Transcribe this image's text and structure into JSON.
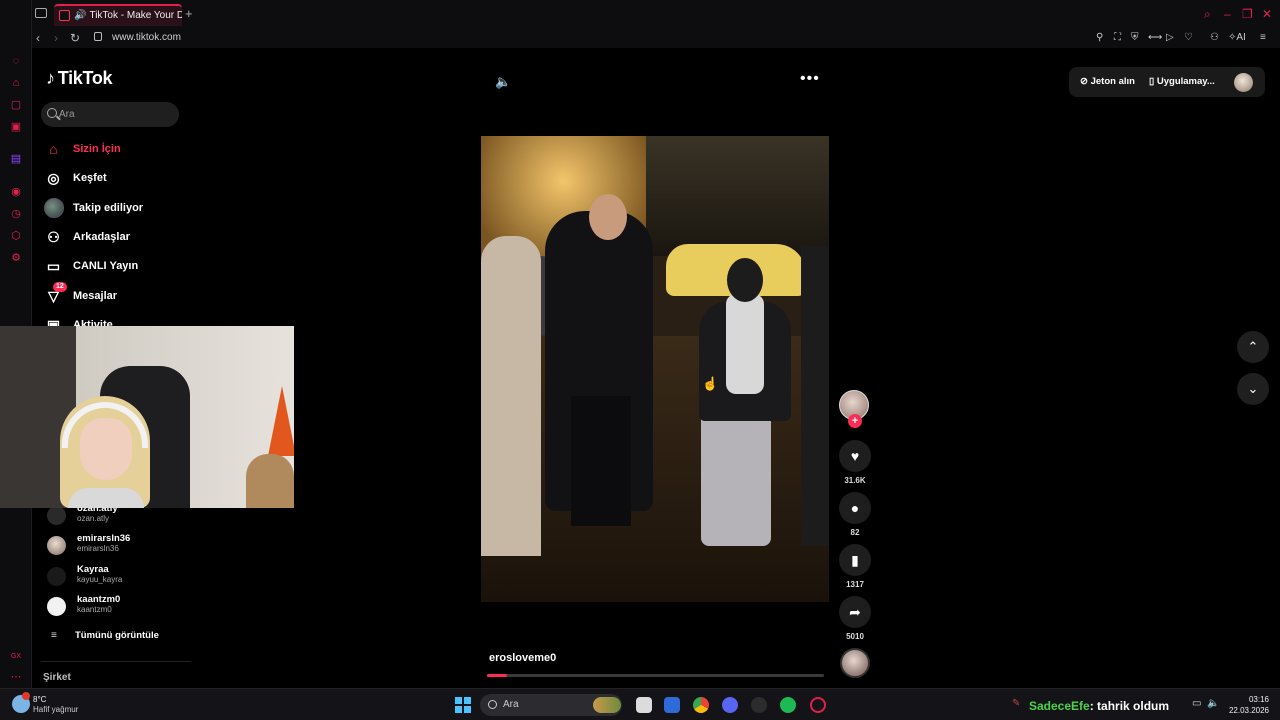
{
  "browser": {
    "tab_title": "TikTok - Make Your Day",
    "url": "www.tiktok.com",
    "new_tab_label": "+"
  },
  "tiktok": {
    "logo_text": "TikTok",
    "search_placeholder": "Ara",
    "nav": [
      {
        "label": "Sizin İçin",
        "icon": "home-icon",
        "active": true
      },
      {
        "label": "Keşfet",
        "icon": "compass-icon"
      },
      {
        "label": "Takip ediliyor",
        "icon": "following-avatar"
      },
      {
        "label": "Arkadaşlar",
        "icon": "friends-icon"
      },
      {
        "label": "CANLI Yayın",
        "icon": "live-tv-icon"
      },
      {
        "label": "Mesajlar",
        "icon": "inbox-icon",
        "badge": "12"
      },
      {
        "label": "Aktivite",
        "icon": "activity-icon"
      }
    ],
    "following_accounts": [
      {
        "name": "ozan.atly",
        "handle": "ozan.atly"
      },
      {
        "name": "emirarsln36",
        "handle": "emirarsln36"
      },
      {
        "name": "Kayraa",
        "handle": "kayuu_kayra"
      },
      {
        "name": "kaantzm0",
        "handle": "kaantzm0"
      }
    ],
    "see_all_label": "Tümünü görüntüle",
    "company_label": "Şirket",
    "top_right": {
      "coins_label": "Jeton alın",
      "app_label": "Uygulamay..."
    },
    "video": {
      "author": "erosloveme0",
      "progress_fraction": 0.06,
      "likes": "31.6K",
      "comments": "82",
      "saves": "1317",
      "shares": "5010"
    }
  },
  "taskbar": {
    "temperature": "8°C",
    "weather": "Hafif yağmur",
    "search_label": "Ara",
    "stream_user": "SadeceEfe",
    "stream_message": ": tahrik oldum",
    "time": "03:16",
    "date": "22.03.2026"
  },
  "colors": {
    "tiktok_accent": "#fe2c55",
    "opera_accent": "#e0204a"
  }
}
